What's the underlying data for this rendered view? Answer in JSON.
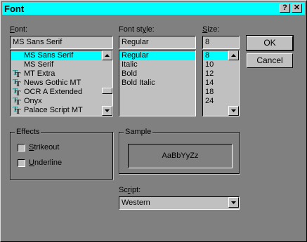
{
  "window": {
    "title": "Font",
    "help_label": "?",
    "close_label": "✕"
  },
  "font": {
    "label_prefix": "",
    "label_accel": "F",
    "label_rest": "ont:",
    "value": "MS Sans Serif",
    "items": [
      {
        "name": "MS Sans Serif",
        "icon": "none",
        "selected": true
      },
      {
        "name": "MS Serif",
        "icon": "none",
        "selected": false
      },
      {
        "name": "MT Extra",
        "icon": "truetype-icon",
        "selected": false
      },
      {
        "name": "News Gothic MT",
        "icon": "truetype-icon",
        "selected": false
      },
      {
        "name": "OCR A Extended",
        "icon": "truetype-icon",
        "selected": false
      },
      {
        "name": "Onyx",
        "icon": "truetype-icon",
        "selected": false
      },
      {
        "name": "Palace Script MT",
        "icon": "truetype-icon",
        "selected": false
      }
    ]
  },
  "style": {
    "label_prefix": "Font st",
    "label_accel": "y",
    "label_rest": "le:",
    "value": "Regular",
    "items": [
      {
        "name": "Regular",
        "selected": true
      },
      {
        "name": "Italic",
        "selected": false
      },
      {
        "name": "Bold",
        "selected": false
      },
      {
        "name": "Bold Italic",
        "selected": false
      }
    ]
  },
  "size": {
    "label_prefix": "",
    "label_accel": "S",
    "label_rest": "ize:",
    "value": "8",
    "items": [
      {
        "name": "8",
        "selected": true
      },
      {
        "name": "10",
        "selected": false
      },
      {
        "name": "12",
        "selected": false
      },
      {
        "name": "14",
        "selected": false
      },
      {
        "name": "18",
        "selected": false
      },
      {
        "name": "24",
        "selected": false
      }
    ]
  },
  "buttons": {
    "ok": "OK",
    "cancel": "Cancel"
  },
  "effects": {
    "title": "Effects",
    "strikeout_accel": "S",
    "strikeout_rest": "trikeout",
    "underline_accel": "U",
    "underline_rest": "nderline"
  },
  "sample": {
    "title": "Sample",
    "text": "AaBbYyZz"
  },
  "script": {
    "label_prefix": "Sc",
    "label_accel": "r",
    "label_rest": "ipt:",
    "value": "Western"
  },
  "colors": {
    "title_bar": "#00ffff",
    "selection": "#00ffff",
    "face": "#808080",
    "control": "#c0c0c0"
  }
}
